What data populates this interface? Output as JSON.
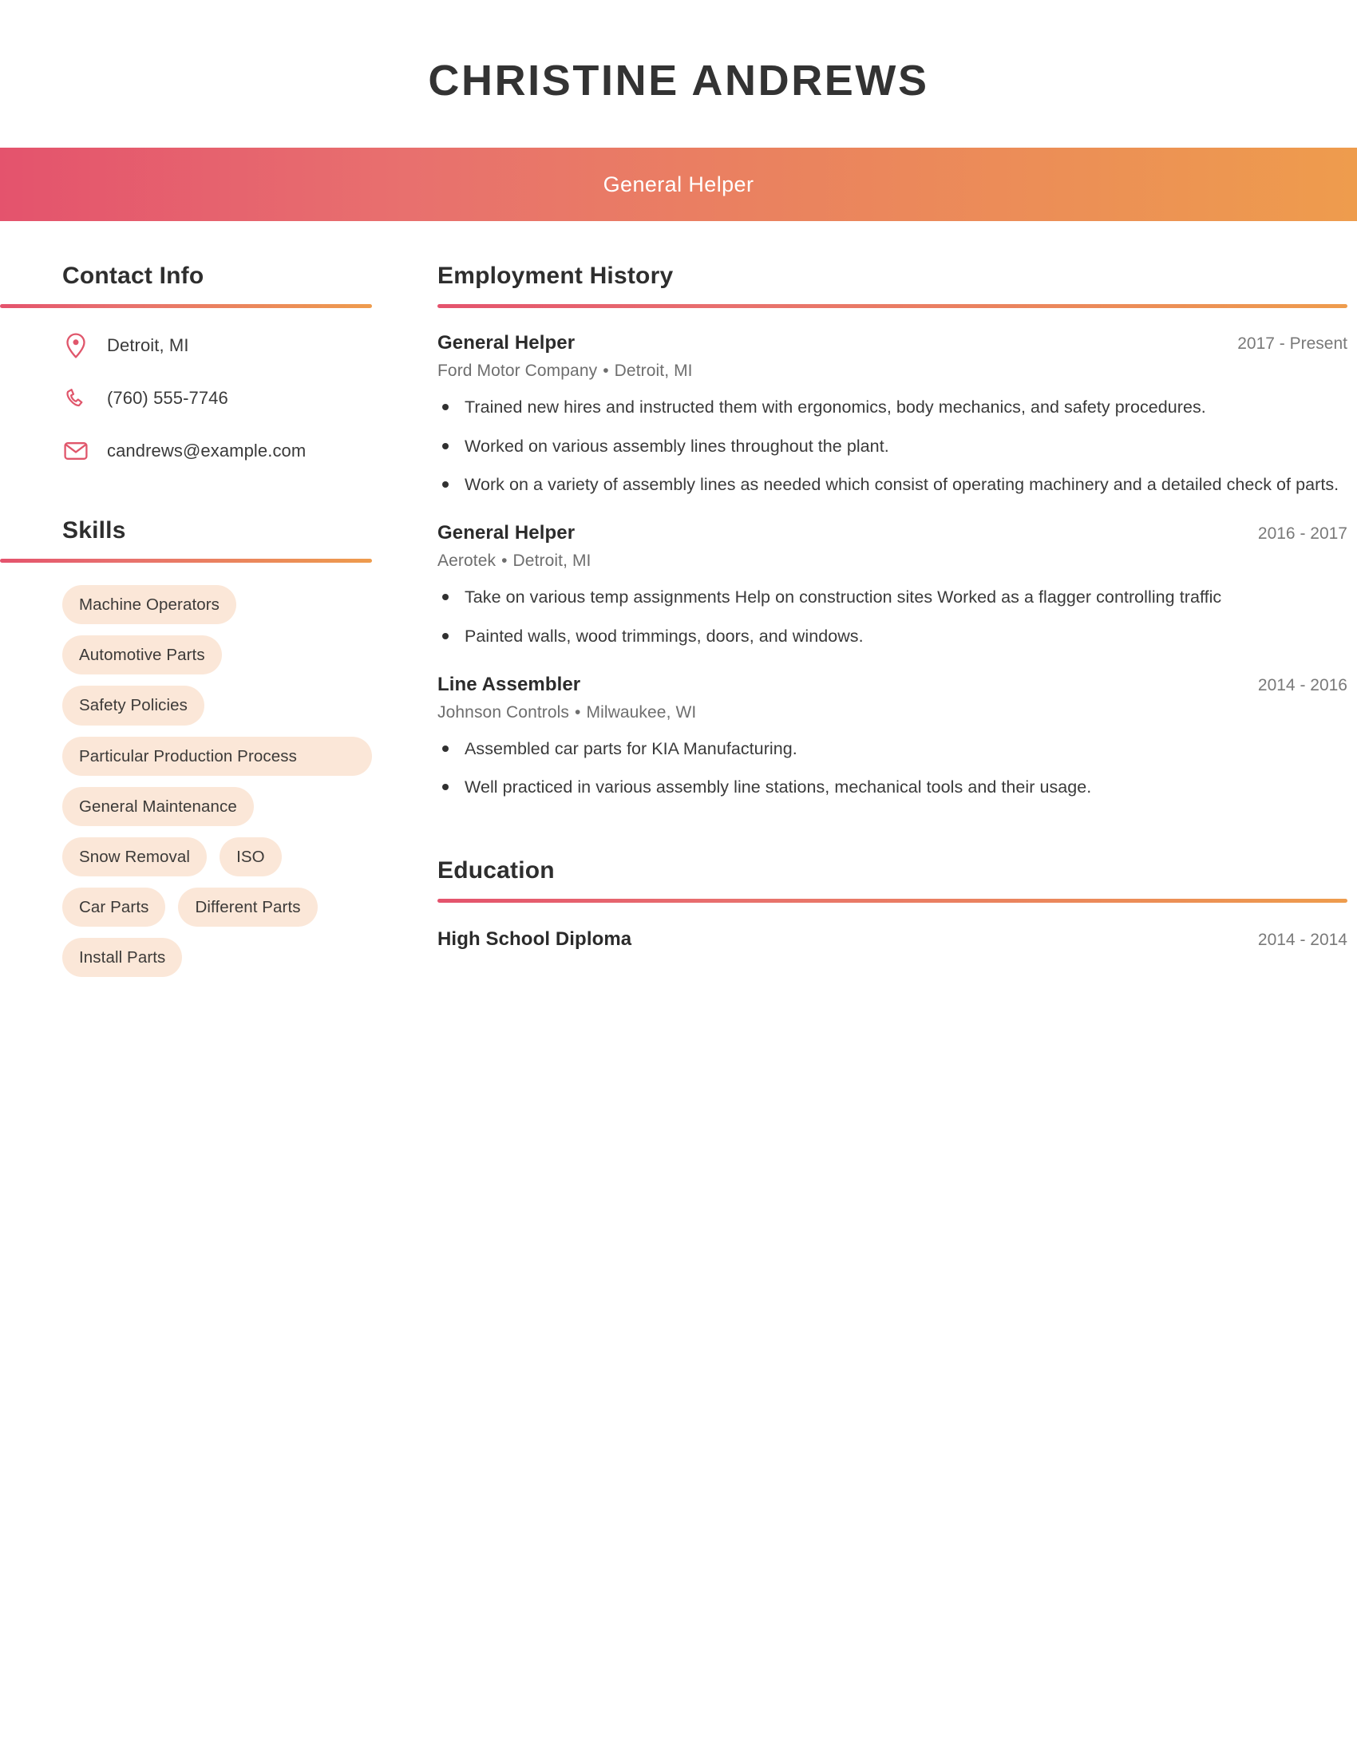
{
  "header": {
    "full_name": "CHRISTINE ANDREWS",
    "job_title": "General Helper"
  },
  "theme": {
    "gradient_start": "#e4536d",
    "gradient_end": "#ee9c4d",
    "icon_color": "#e0566b",
    "pill_background": "#fbe7d8",
    "heading_color": "#2e2e2e"
  },
  "sidebar": {
    "contact": {
      "heading": "Contact Info",
      "items": [
        {
          "icon": "location-pin-icon",
          "value": "Detroit, MI"
        },
        {
          "icon": "phone-icon",
          "value": "(760) 555-7746"
        },
        {
          "icon": "envelope-icon",
          "value": "candrews@example.com"
        }
      ]
    },
    "skills": {
      "heading": "Skills",
      "items": [
        {
          "label": "Machine Operators",
          "wide": false
        },
        {
          "label": "Automotive Parts",
          "wide": false
        },
        {
          "label": "Safety Policies",
          "wide": false
        },
        {
          "label": "Particular Production Process",
          "wide": true
        },
        {
          "label": "General Maintenance",
          "wide": false
        },
        {
          "label": "Snow Removal",
          "wide": false
        },
        {
          "label": "ISO",
          "wide": false
        },
        {
          "label": "Car Parts",
          "wide": false
        },
        {
          "label": "Different Parts",
          "wide": false
        },
        {
          "label": "Install Parts",
          "wide": false
        }
      ]
    }
  },
  "main": {
    "employment": {
      "heading": "Employment History",
      "entries": [
        {
          "role": "General Helper",
          "dates": "2017 - Present",
          "company": "Ford Motor Company",
          "separator": "•",
          "location": "Detroit, MI",
          "bullets": [
            "Trained new hires and instructed them with ergonomics, body mechanics, and safety procedures.",
            "Worked on various assembly lines throughout the plant.",
            "Work on a variety of assembly lines as needed which consist of operating machinery and a detailed check of parts."
          ]
        },
        {
          "role": "General Helper",
          "dates": "2016 - 2017",
          "company": "Aerotek",
          "separator": "•",
          "location": "Detroit, MI",
          "bullets": [
            "Take on various temp assignments Help on construction sites Worked as a flagger controlling traffic",
            "Painted walls, wood trimmings, doors, and windows."
          ]
        },
        {
          "role": "Line Assembler",
          "dates": "2014 - 2016",
          "company": "Johnson Controls",
          "separator": "•",
          "location": "Milwaukee, WI",
          "bullets": [
            "Assembled car parts for KIA Manufacturing.",
            "Well practiced in various assembly line stations, mechanical tools and their usage."
          ]
        }
      ]
    },
    "education": {
      "heading": "Education",
      "entries": [
        {
          "degree": "High School Diploma",
          "dates": "2014 - 2014"
        }
      ]
    }
  }
}
